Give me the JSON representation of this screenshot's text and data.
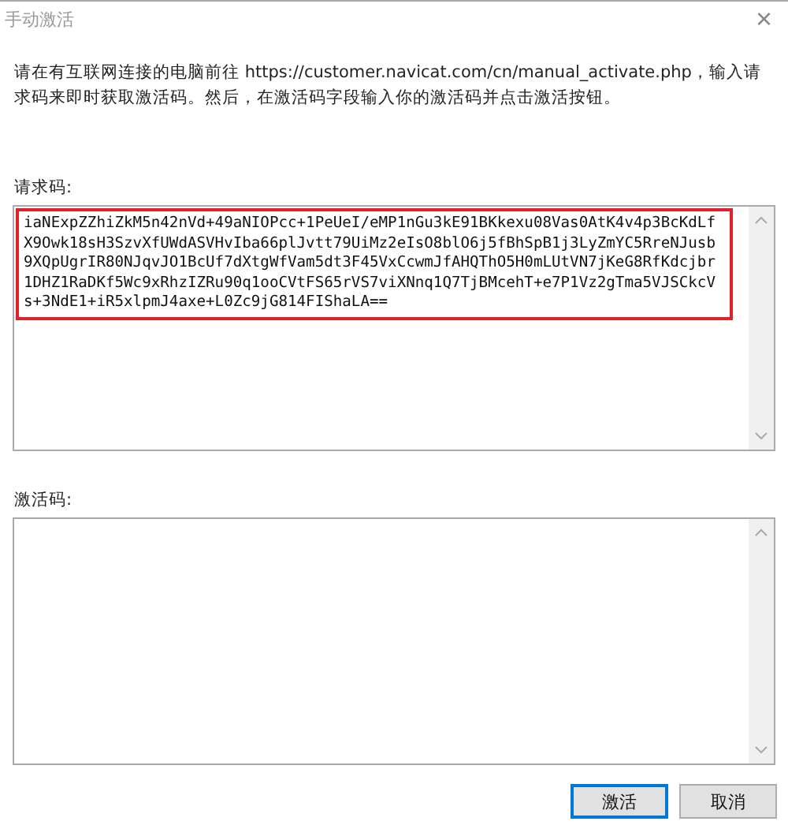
{
  "window": {
    "title": "手动激活",
    "close": "×"
  },
  "instructions": "请在有互联网连接的电脑前往 https://customer.navicat.com/cn/manual_activate.php，输入请求码来即时获取激活码。然后，在激活码字段输入你的激活码并点击激活按钮。",
  "request_code": {
    "label": "请求码:",
    "highlighted": true,
    "lines": [
      "iaNExpZZhiZkM5n42nVd+49aNIOPcc+1PeUeI/eMP1nGu3kE91BKkexu08Vas0AtK4v4p3BcKdLf",
      "X9Owk18sH3SzvXfUWdASVHvIba66plJvtt79UiMz2eIsO8blO6j5fBhSpB1j3LyZmYC5RreNJusb",
      "9XQpUgrIR80NJqvJO1BcUf7dXtgWfVam5dt3F45VxCcwmJfAHQThO5H0mLUtVN7jKeG8RfKdcjbr",
      "1DHZ1RaDKf5Wc9xRhzIZRu90q1ooCVtFS65rVS7viXNnq1Q7TjBMcehT+e7P1Vz2gTma5VJSCkcV",
      "s+3NdE1+iR5xlpmJ4axe+L0Zc9jG814FIShaLA=="
    ]
  },
  "activation_code": {
    "label": "激活码:"
  },
  "buttons": [
    {
      "label": "激活",
      "focused": true
    },
    {
      "label": "取消",
      "focused": false
    }
  ]
}
